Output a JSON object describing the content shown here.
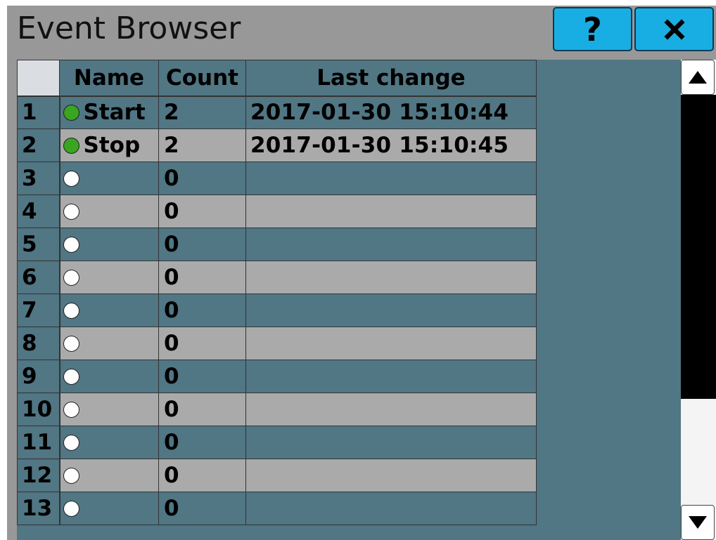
{
  "window": {
    "title": "Event Browser"
  },
  "buttons": {
    "help_label": "?",
    "close_icon": "close-icon"
  },
  "colors": {
    "button_blue": "#19aee3",
    "row_dark": "#517684",
    "row_light": "#abaaab",
    "status_green": "#39a520",
    "frame_gray": "#999898"
  },
  "table": {
    "headers": {
      "row_number": "",
      "name": "Name",
      "count": "Count",
      "last_change": "Last change"
    },
    "rows": [
      {
        "num": "1",
        "active": true,
        "name": "Start",
        "count": "2",
        "last_change": "2017-01-30 15:10:44"
      },
      {
        "num": "2",
        "active": true,
        "name": "Stop",
        "count": "2",
        "last_change": "2017-01-30 15:10:45"
      },
      {
        "num": "3",
        "active": false,
        "name": "",
        "count": "0",
        "last_change": ""
      },
      {
        "num": "4",
        "active": false,
        "name": "",
        "count": "0",
        "last_change": ""
      },
      {
        "num": "5",
        "active": false,
        "name": "",
        "count": "0",
        "last_change": ""
      },
      {
        "num": "6",
        "active": false,
        "name": "",
        "count": "0",
        "last_change": ""
      },
      {
        "num": "7",
        "active": false,
        "name": "",
        "count": "0",
        "last_change": ""
      },
      {
        "num": "8",
        "active": false,
        "name": "",
        "count": "0",
        "last_change": ""
      },
      {
        "num": "9",
        "active": false,
        "name": "",
        "count": "0",
        "last_change": ""
      },
      {
        "num": "10",
        "active": false,
        "name": "",
        "count": "0",
        "last_change": ""
      },
      {
        "num": "11",
        "active": false,
        "name": "",
        "count": "0",
        "last_change": ""
      },
      {
        "num": "12",
        "active": false,
        "name": "",
        "count": "0",
        "last_change": ""
      },
      {
        "num": "13",
        "active": false,
        "name": "",
        "count": "0",
        "last_change": ""
      }
    ]
  },
  "scrollbar": {
    "up_icon": "triangle-up-icon",
    "down_icon": "triangle-down-icon"
  }
}
